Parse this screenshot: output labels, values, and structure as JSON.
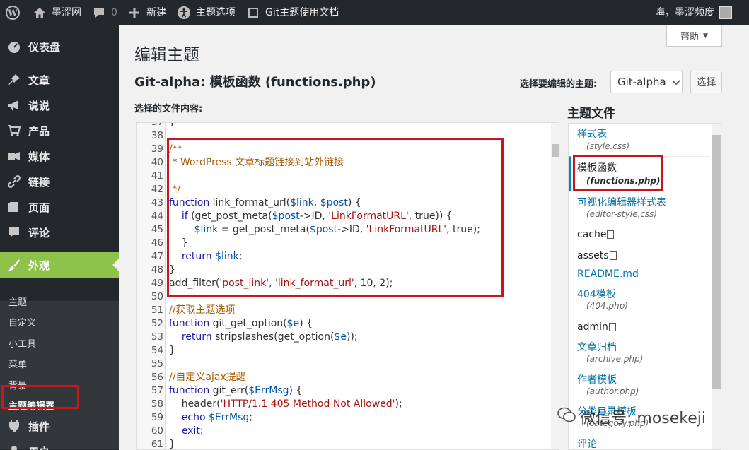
{
  "adminbar": {
    "site_name": "墨涩网",
    "comments_count": "0",
    "new_label": "新建",
    "theme_options": "主题选项",
    "docs": "Git主题使用文档",
    "greeting": "晦，墨涩频度"
  },
  "sidebar": {
    "items": [
      {
        "label": "仪表盘",
        "icon": "dashboard-icon"
      },
      {
        "label": "文章",
        "icon": "pin-icon"
      },
      {
        "label": "说说",
        "icon": "megaphone-icon"
      },
      {
        "label": "产品",
        "icon": "cart-icon"
      },
      {
        "label": "媒体",
        "icon": "media-icon"
      },
      {
        "label": "链接",
        "icon": "link-icon"
      },
      {
        "label": "页面",
        "icon": "page-icon"
      },
      {
        "label": "评论",
        "icon": "comment-icon"
      },
      {
        "label": "外观",
        "icon": "brush-icon"
      }
    ],
    "submenu": [
      "主题",
      "自定义",
      "小工具",
      "菜单",
      "背景",
      "主题编辑器"
    ],
    "after": [
      {
        "label": "插件",
        "icon": "plugin-icon"
      },
      {
        "label": "用户",
        "icon": "user-icon"
      }
    ],
    "active_color": "#8dc34a"
  },
  "header": {
    "help": "帮助",
    "title": "编辑主题",
    "file_title": "Git-alpha: 模板函数 (functions.php)",
    "select_label": "选择要编辑的主题:",
    "selected_theme": "Git-alpha",
    "select_button": "选择",
    "content_label": "选择的文件内容:",
    "files_heading": "主题文件"
  },
  "editor": {
    "lines": [
      {
        "n": "37",
        "t": "}"
      },
      {
        "n": "38",
        "t": ""
      },
      {
        "n": "39",
        "t": "/**"
      },
      {
        "n": "40",
        "t": " * WordPress 文章标题链接到站外链接"
      },
      {
        "n": "41",
        "t": ""
      },
      {
        "n": "42",
        "t": " */"
      },
      {
        "n": "43",
        "t": "function link_format_url($link, $post) {"
      },
      {
        "n": "44",
        "t": "    if (get_post_meta($post->ID, 'LinkFormatURL', true)) {"
      },
      {
        "n": "45",
        "t": "        $link = get_post_meta($post->ID, 'LinkFormatURL', true);"
      },
      {
        "n": "46",
        "t": "    }"
      },
      {
        "n": "47",
        "t": "    return $link;"
      },
      {
        "n": "48",
        "t": "}"
      },
      {
        "n": "49",
        "t": "add_filter('post_link', 'link_format_url', 10, 2);"
      },
      {
        "n": "50",
        "t": ""
      },
      {
        "n": "51",
        "t": "//获取主题选项"
      },
      {
        "n": "52",
        "t": "function git_get_option($e) {"
      },
      {
        "n": "53",
        "t": "    return stripslashes(get_option($e));"
      },
      {
        "n": "54",
        "t": "}"
      },
      {
        "n": "55",
        "t": ""
      },
      {
        "n": "56",
        "t": "//自定义ajax提醒"
      },
      {
        "n": "57",
        "t": "function git_err($ErrMsg) {"
      },
      {
        "n": "58",
        "t": "    header('HTTP/1.1 405 Method Not Allowed');"
      },
      {
        "n": "59",
        "t": "    echo $ErrMsg;"
      },
      {
        "n": "60",
        "t": "    exit;"
      },
      {
        "n": "61",
        "t": "}"
      }
    ],
    "highlight_color": "#c9151e"
  },
  "files": [
    {
      "name": "样式表",
      "file": "(style.css)"
    },
    {
      "name": "模板函数",
      "file": "(functions.php)",
      "active": true
    },
    {
      "name": "可视化编辑器样式表",
      "file": "(editor-style.css)"
    },
    {
      "folder": "cache"
    },
    {
      "folder": "assets"
    },
    {
      "name": "README.md"
    },
    {
      "name": "404模板",
      "file": "(404.php)"
    },
    {
      "folder": "admin"
    },
    {
      "name": "文章归档",
      "file": "(archive.php)"
    },
    {
      "name": "作者模板",
      "file": "(author.php)"
    },
    {
      "name": "分类目录模板",
      "file": "(category.php)"
    },
    {
      "name": "评论"
    }
  ],
  "watermark": "微信号: mosekeji"
}
